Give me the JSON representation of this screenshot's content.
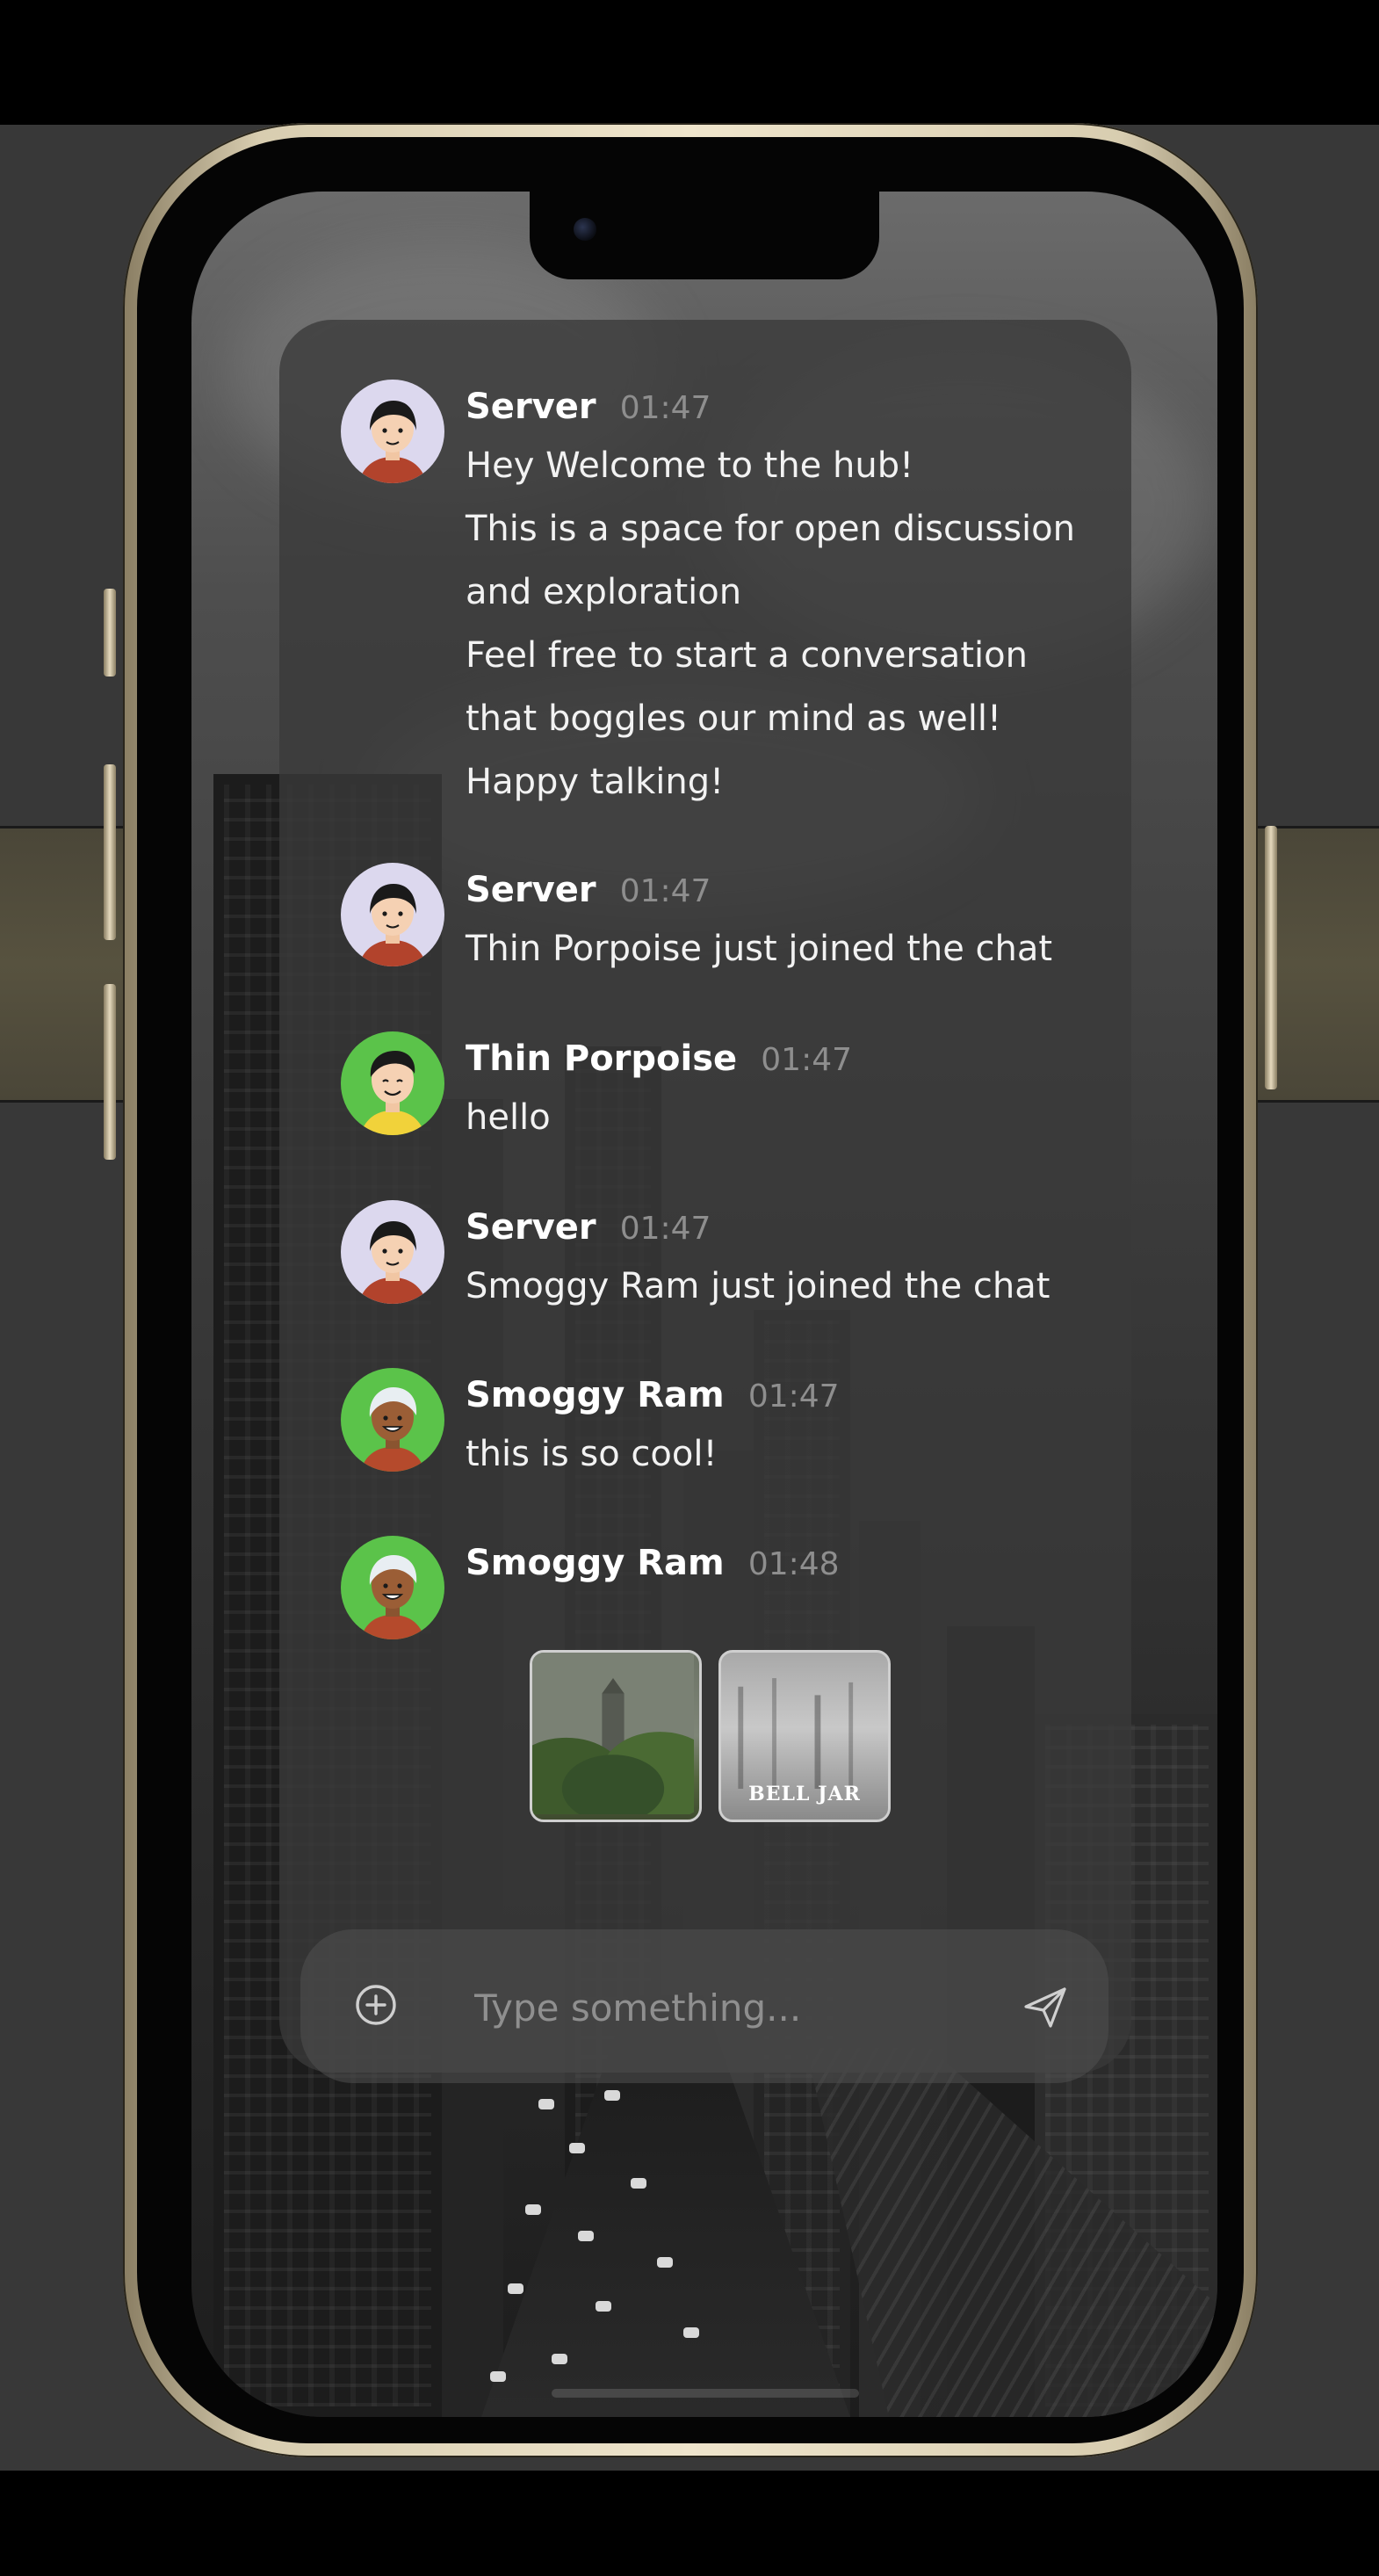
{
  "chat": {
    "messages": [
      {
        "sender": "Server",
        "time": "01:47",
        "lines": [
          "Hey Welcome to the hub!",
          "This is a space for open discussion",
          "and exploration",
          "Feel free to start a conversation",
          "that boggles our mind as well!",
          "Happy talking!"
        ],
        "avatar": "server-avatar"
      },
      {
        "sender": "Server",
        "time": "01:47",
        "lines": [
          "Thin Porpoise just joined the chat"
        ],
        "avatar": "server-avatar"
      },
      {
        "sender": "Thin Porpoise",
        "time": "01:47",
        "lines": [
          "hello"
        ],
        "avatar": "thin-porpoise-avatar"
      },
      {
        "sender": "Server",
        "time": "01:47",
        "lines": [
          "Smoggy Ram just joined the chat"
        ],
        "avatar": "server-avatar"
      },
      {
        "sender": "Smoggy Ram",
        "time": "01:47",
        "lines": [
          "this is so cool!"
        ],
        "avatar": "smoggy-ram-avatar"
      },
      {
        "sender": "Smoggy Ram",
        "time": "01:48",
        "lines": [],
        "avatar": "smoggy-ram-avatar",
        "attachments": [
          {
            "kind": "image",
            "caption": ""
          },
          {
            "kind": "image",
            "caption": "BELL JAR"
          }
        ]
      }
    ]
  },
  "composer": {
    "placeholder": "Type something...",
    "add_icon": "plus-circle-icon",
    "send_icon": "send-icon"
  },
  "colors": {
    "name_text": "#ffffff",
    "time_text": "#8e8e8e",
    "message_text": "#f2f2f2",
    "server_avatar_bg": "#dcd8ee",
    "user_avatar_bg": "#5bc34a"
  }
}
